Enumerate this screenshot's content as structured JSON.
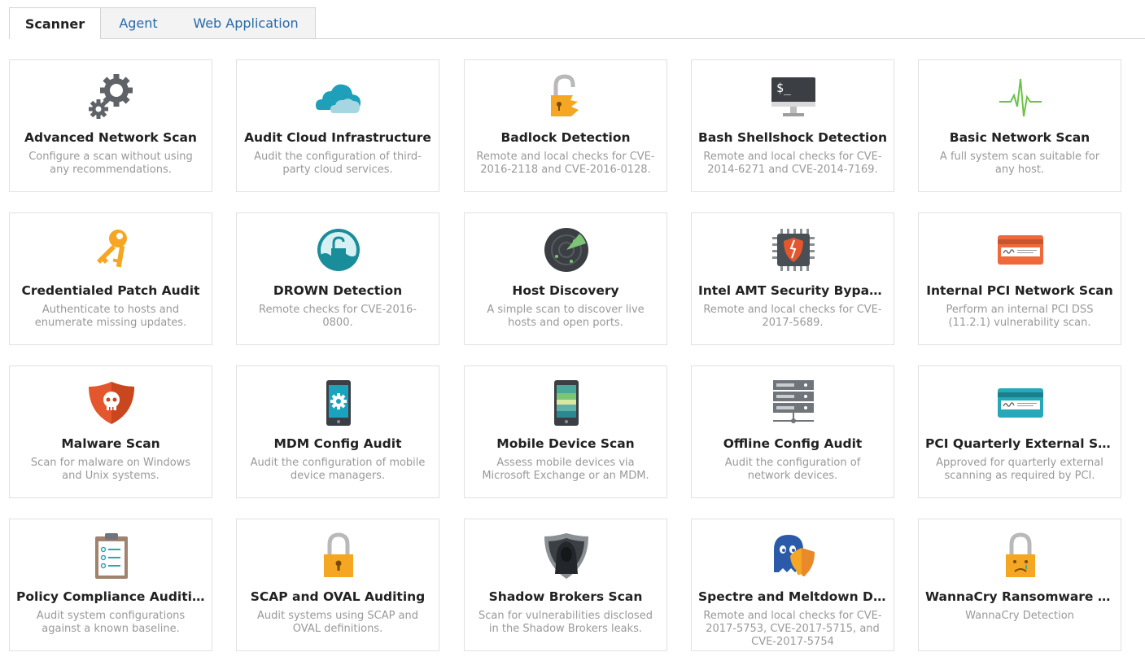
{
  "tabs": [
    {
      "label": "Scanner",
      "active": true
    },
    {
      "label": "Agent",
      "active": false
    },
    {
      "label": "Web Application",
      "active": false
    }
  ],
  "templates": [
    {
      "title": "Advanced Network Scan",
      "desc": "Configure a scan without using any recommendations.",
      "icon": "gears-icon"
    },
    {
      "title": "Audit Cloud Infrastructure",
      "desc": "Audit the configuration of third-party cloud services.",
      "icon": "cloud-icon"
    },
    {
      "title": "Badlock Detection",
      "desc": "Remote and local checks for CVE-2016-2118 and CVE-2016-0128.",
      "icon": "broken-padlock-icon"
    },
    {
      "title": "Bash Shellshock Detection",
      "desc": "Remote and local checks for CVE-2014-6271 and CVE-2014-7169.",
      "icon": "terminal-monitor-icon"
    },
    {
      "title": "Basic Network Scan",
      "desc": "A full system scan suitable for any host.",
      "icon": "pulse-icon"
    },
    {
      "title": "Credentialed Patch Audit",
      "desc": "Authenticate to hosts and enumerate missing updates.",
      "icon": "keys-icon"
    },
    {
      "title": "DROWN Detection",
      "desc": "Remote checks for CVE-2016-0800.",
      "icon": "drowning-lock-icon"
    },
    {
      "title": "Host Discovery",
      "desc": "A simple scan to discover live hosts and open ports.",
      "icon": "radar-icon"
    },
    {
      "title": "Intel AMT Security Bypass ...",
      "desc": "Remote and local checks for CVE-2017-5689.",
      "icon": "chip-shield-icon"
    },
    {
      "title": "Internal PCI Network Scan",
      "desc": "Perform an internal PCI DSS (11.2.1) vulnerability scan.",
      "icon": "credit-card-orange-icon"
    },
    {
      "title": "Malware Scan",
      "desc": "Scan for malware on Windows and Unix systems.",
      "icon": "skull-shield-icon"
    },
    {
      "title": "MDM Config Audit",
      "desc": "Audit the configuration of mobile device managers.",
      "icon": "phone-gear-icon"
    },
    {
      "title": "Mobile Device Scan",
      "desc": "Assess mobile devices via Microsoft Exchange or an MDM.",
      "icon": "mobile-phone-icon"
    },
    {
      "title": "Offline Config Audit",
      "desc": "Audit the configuration of network devices.",
      "icon": "server-rack-icon"
    },
    {
      "title": "PCI Quarterly External Scan",
      "desc": "Approved for quarterly external scanning as required by PCI.",
      "icon": "credit-card-teal-icon"
    },
    {
      "title": "Policy Compliance Auditing",
      "desc": "Audit system configurations against a known baseline.",
      "icon": "clipboard-icon"
    },
    {
      "title": "SCAP and OVAL Auditing",
      "desc": "Audit systems using SCAP and OVAL definitions.",
      "icon": "padlock-icon"
    },
    {
      "title": "Shadow Brokers Scan",
      "desc": "Scan for vulnerabilities disclosed in the Shadow Brokers leaks.",
      "icon": "hooded-figure-icon"
    },
    {
      "title": "Spectre and Meltdown Det...",
      "desc": "Remote and local checks for CVE-2017-5753, CVE-2017-5715, and CVE-2017-5754",
      "icon": "ghost-melting-shield-icon"
    },
    {
      "title": "WannaCry Ransomware De...",
      "desc": "WannaCry Detection",
      "icon": "crying-padlock-icon"
    }
  ]
}
